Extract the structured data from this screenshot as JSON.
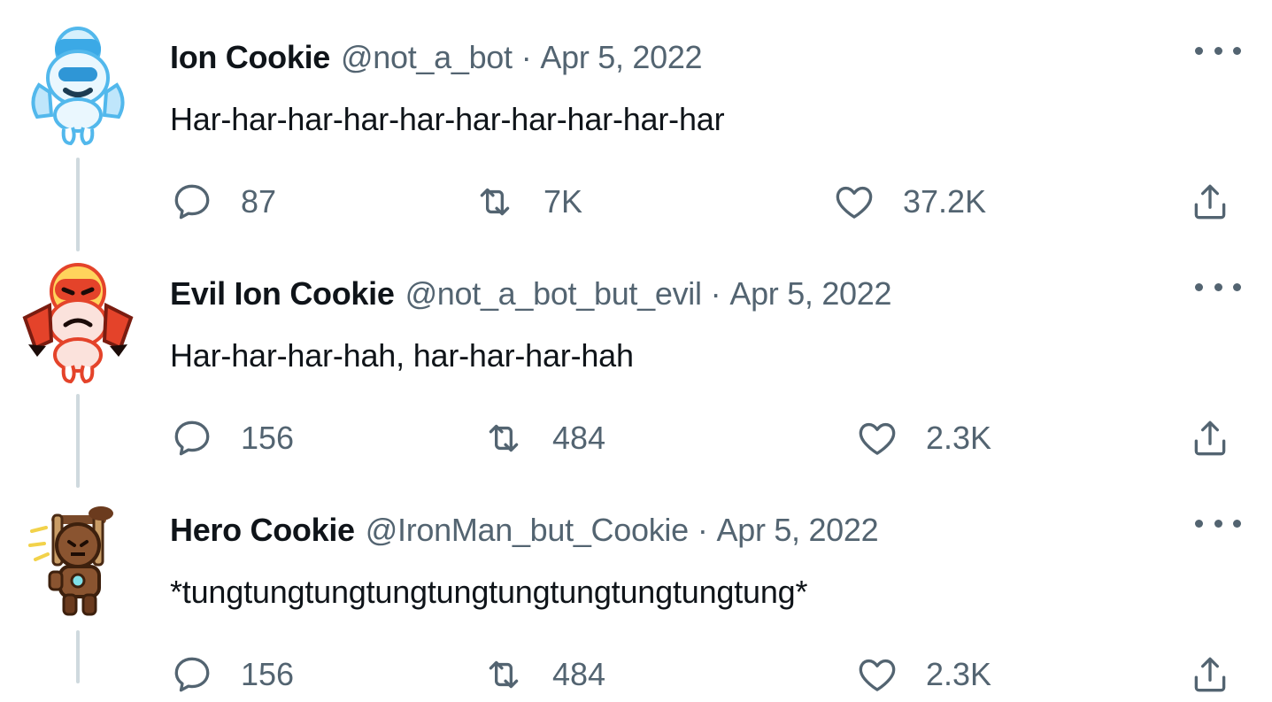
{
  "tweets": [
    {
      "display_name": "Ion Cookie",
      "handle": "@not_a_bot",
      "separator": "·",
      "date": "Apr 5, 2022",
      "text": "Har-har-har-har-har-har-har-har-har-har",
      "replies": "87",
      "retweets": "7K",
      "likes": "37.2K",
      "avatar_icon": "blue-robot-cookie-avatar",
      "accent": "#52b8ec"
    },
    {
      "display_name": "Evil Ion Cookie",
      "handle": "@not_a_bot_but_evil",
      "separator": "·",
      "date": "Apr 5, 2022",
      "text": "Har-har-har-hah, har-har-har-hah",
      "replies": "156",
      "retweets": "484",
      "likes": "2.3K",
      "avatar_icon": "red-robot-cookie-avatar",
      "accent": "#e4432a"
    },
    {
      "display_name": "Hero Cookie",
      "handle": "@IronMan_but_Cookie",
      "separator": "·",
      "date": "Apr 5, 2022",
      "text": "*tungtungtungtungtungtungtungtungtungtung*",
      "replies": "156",
      "retweets": "484",
      "likes": "2.3K",
      "avatar_icon": "brown-hero-cookie-avatar",
      "accent": "#7a4a2a"
    }
  ],
  "icons": {
    "reply": "reply-icon",
    "retweet": "retweet-icon",
    "like": "like-icon",
    "share": "share-icon",
    "more": "more-options-icon"
  },
  "colors": {
    "text_primary": "#0f1419",
    "text_secondary": "#536471",
    "thread_line": "#cfd9de"
  }
}
